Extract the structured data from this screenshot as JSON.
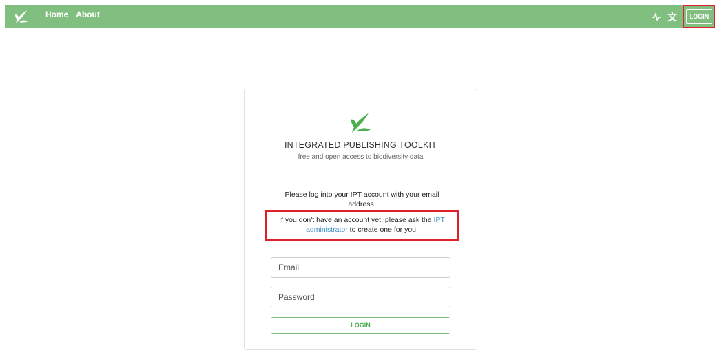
{
  "colors": {
    "navbar_bg": "#81bf81",
    "accent_green": "#4caf50",
    "link_blue": "#3c8fc7",
    "highlight_red": "#e0202a"
  },
  "navbar": {
    "logo_icon": "leaf-logo-icon",
    "links": [
      "Home",
      "About"
    ],
    "health_icon": "pulse-icon",
    "language_icon": "translate-icon",
    "login_label": "LOGIN"
  },
  "card": {
    "logo_icon": "leaf-logo-icon",
    "title": "INTEGRATED PUBLISHING TOOLKIT",
    "subtitle": "free and open access to biodiversity data",
    "intro_line1": "Please log into your IPT account with your email",
    "intro_line2": "address.",
    "note_before_link": "If you don't have an account yet, please ask the ",
    "note_link_part1": "IPT",
    "note_link_part2": "administrator",
    "note_after_link": " to create one for you.",
    "email_placeholder": "Email",
    "password_placeholder": "Password",
    "login_button": "LOGIN"
  }
}
